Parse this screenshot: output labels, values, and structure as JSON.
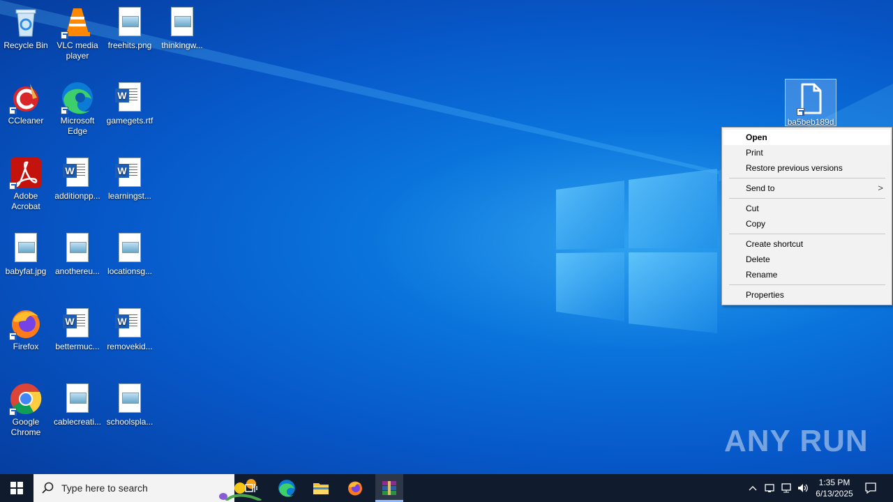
{
  "desktop_icons": [
    {
      "label": "Recycle Bin",
      "icon": "recycle-bin-icon"
    },
    {
      "label": "VLC media player",
      "icon": "vlc-icon"
    },
    {
      "label": "freehits.png",
      "icon": "image-file-icon"
    },
    {
      "label": "thinkingw...",
      "icon": "image-file-icon"
    },
    {
      "label": "CCleaner",
      "icon": "ccleaner-icon"
    },
    {
      "label": "Microsoft Edge",
      "icon": "edge-icon"
    },
    {
      "label": "gamegets.rtf",
      "icon": "word-file-icon"
    },
    {
      "label": "Adobe Acrobat",
      "icon": "acrobat-icon"
    },
    {
      "label": "additionpp...",
      "icon": "word-file-icon"
    },
    {
      "label": "learningst...",
      "icon": "word-file-icon"
    },
    {
      "label": "babyfat.jpg",
      "icon": "image-file-icon"
    },
    {
      "label": "anothereu...",
      "icon": "image-file-icon"
    },
    {
      "label": "locationsg...",
      "icon": "image-file-icon"
    },
    {
      "label": "Firefox",
      "icon": "firefox-icon"
    },
    {
      "label": "bettermuc...",
      "icon": "word-file-icon"
    },
    {
      "label": "removekid...",
      "icon": "word-file-icon"
    },
    {
      "label": "Google Chrome",
      "icon": "chrome-icon"
    },
    {
      "label": "cablecreati...",
      "icon": "image-file-icon"
    },
    {
      "label": "schoolspla...",
      "icon": "image-file-icon"
    }
  ],
  "selected_file": {
    "label": "ba5beb189d6",
    "icon": "blank-file-icon"
  },
  "context_menu": {
    "items": [
      {
        "label": "Open",
        "bold": true
      },
      {
        "label": "Print"
      },
      {
        "label": "Restore previous versions"
      },
      {
        "label": "Send to",
        "submenu": true
      },
      {
        "label": "Cut"
      },
      {
        "label": "Copy"
      },
      {
        "label": "Create shortcut"
      },
      {
        "label": "Delete"
      },
      {
        "label": "Rename"
      },
      {
        "label": "Properties"
      }
    ],
    "submenu_arrow": ">"
  },
  "watermark": "ANY RUN",
  "taskbar": {
    "search_placeholder": "Type here to search",
    "time": "1:35 PM",
    "date": "6/13/2025"
  },
  "colors": {
    "taskbar": "#101c2e",
    "menu_bg": "#f2f2f2",
    "accent": "#0a74dc"
  }
}
